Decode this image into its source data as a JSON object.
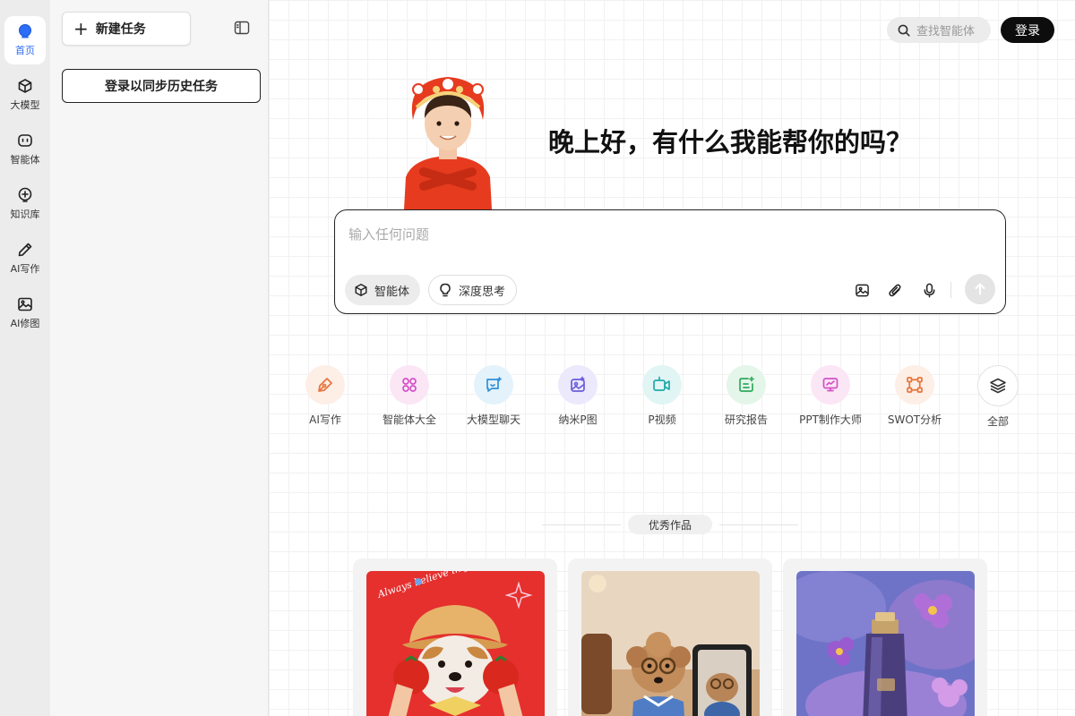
{
  "rail": {
    "items": [
      {
        "label": "首页",
        "icon": "home-icon",
        "active": true
      },
      {
        "label": "大模型",
        "icon": "cube-icon"
      },
      {
        "label": "智能体",
        "icon": "robot-icon"
      },
      {
        "label": "知识库",
        "icon": "knowledge-icon"
      },
      {
        "label": "AI写作",
        "icon": "pen-icon"
      },
      {
        "label": "AI修图",
        "icon": "image-icon"
      }
    ]
  },
  "panel": {
    "new_task_label": "新建任务",
    "login_sync_label": "登录以同步历史任务"
  },
  "header": {
    "search_placeholder": "查找智能体",
    "login_label": "登录"
  },
  "hero": {
    "greeting": "晚上好，有什么我能帮你的吗？"
  },
  "composer": {
    "placeholder": "输入任何问题",
    "chip_agent": "智能体",
    "chip_think": "深度思考"
  },
  "features": [
    {
      "label": "AI写作",
      "icon": "pen-nib-icon",
      "bg": "#fdeee6",
      "color": "#e8743b"
    },
    {
      "label": "智能体大全",
      "icon": "grid-icon",
      "bg": "#fbe6f6",
      "color": "#d451c6"
    },
    {
      "label": "大模型聊天",
      "icon": "chat-icon",
      "bg": "#e3f2fb",
      "color": "#2f8fd8"
    },
    {
      "label": "纳米P图",
      "icon": "photo-edit-icon",
      "bg": "#ebe9fb",
      "color": "#6a5cdc"
    },
    {
      "label": "P视频",
      "icon": "video-icon",
      "bg": "#e2f5f5",
      "color": "#1faaa8"
    },
    {
      "label": "研究报告",
      "icon": "report-icon",
      "bg": "#e4f5ea",
      "color": "#2eab5c"
    },
    {
      "label": "PPT制作大师",
      "icon": "presentation-icon",
      "bg": "#fbe6f6",
      "color": "#d451c6"
    },
    {
      "label": "SWOT分析",
      "icon": "nodes-icon",
      "bg": "#fdeee6",
      "color": "#e8743b"
    },
    {
      "label": "全部",
      "icon": "layers-icon",
      "bg": "#ffffff",
      "color": "#333333"
    }
  ],
  "showcase": {
    "title": "优秀作品",
    "cards": [
      {
        "name": "dog-tomato-card",
        "caption": "Always believe in yourself..."
      },
      {
        "name": "poodle-mirror-card"
      },
      {
        "name": "perfume-flowers-card"
      }
    ]
  },
  "colors": {
    "accent": "#2d6ef6",
    "dark": "#0d0d0d"
  }
}
